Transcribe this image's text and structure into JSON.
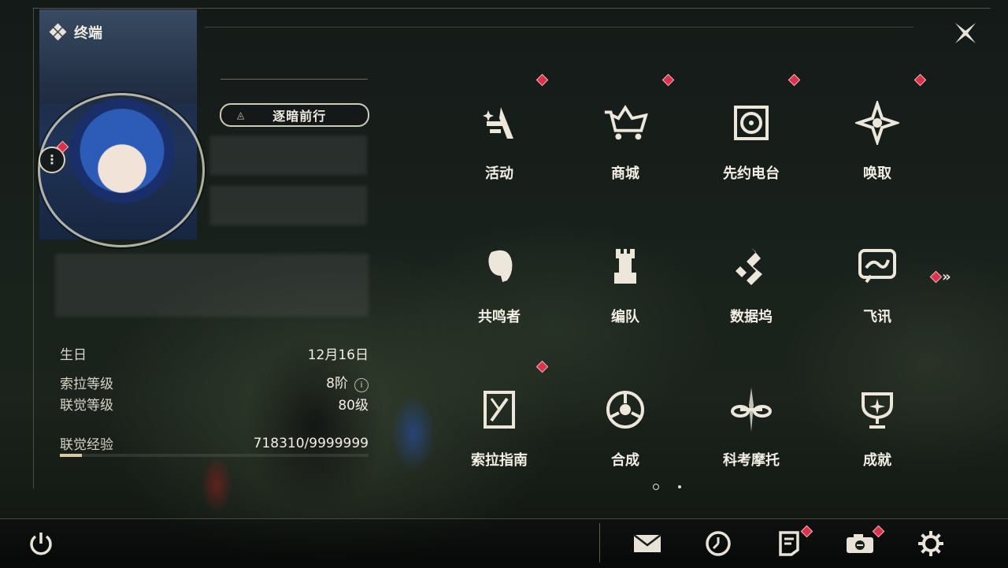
{
  "header": {
    "title": "终端"
  },
  "profile": {
    "title_badge": "逐暗前行",
    "info": [
      {
        "label": "生日",
        "value": "12月16日"
      },
      {
        "label": "索拉等级",
        "value": "8阶"
      },
      {
        "label": "联觉等级",
        "value": "80级"
      },
      {
        "label": "联觉经验",
        "value": "718310/9999999"
      }
    ],
    "exp_progress": 0.0718
  },
  "menu": {
    "items": [
      {
        "label": "活动",
        "icon": "activity-icon",
        "badge": true
      },
      {
        "label": "商城",
        "icon": "shopping-cart-icon",
        "badge": true
      },
      {
        "label": "先约电台",
        "icon": "radio-icon",
        "badge": true
      },
      {
        "label": "唤取",
        "icon": "summon-compass-icon",
        "badge": true
      },
      {
        "label": "共鸣者",
        "icon": "resonator-head-icon",
        "badge": false
      },
      {
        "label": "编队",
        "icon": "chess-rook-icon",
        "badge": false
      },
      {
        "label": "数据坞",
        "icon": "databank-icon",
        "badge": false
      },
      {
        "label": "飞讯",
        "icon": "message-chat-icon",
        "badge": false
      },
      {
        "label": "索拉指南",
        "icon": "guide-book-icon",
        "badge": true
      },
      {
        "label": "合成",
        "icon": "synthesis-icon",
        "badge": false
      },
      {
        "label": "科考摩托",
        "icon": "motorcycle-icon",
        "badge": false
      },
      {
        "label": "成就",
        "icon": "trophy-icon",
        "badge": false
      }
    ],
    "page_indicator": {
      "total": 2,
      "current": 1
    }
  },
  "bottom_bar": {
    "buttons": [
      {
        "icon": "power-icon",
        "badge": false
      },
      {
        "icon": "mail-icon",
        "badge": false
      },
      {
        "icon": "clock-icon",
        "badge": false
      },
      {
        "icon": "notice-icon",
        "badge": true
      },
      {
        "icon": "camera-icon",
        "badge": true
      },
      {
        "icon": "settings-gear-icon",
        "badge": false
      }
    ]
  },
  "colors": {
    "accent_gold": "#cfc9b6",
    "badge_red": "#d9324a",
    "text": "#f2eee4"
  }
}
